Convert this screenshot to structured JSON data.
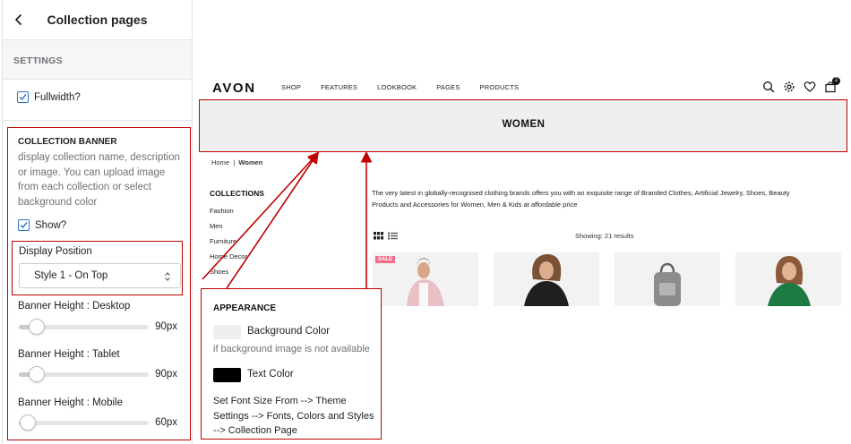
{
  "panel": {
    "title": "Collection pages",
    "settings_label": "SETTINGS",
    "fullwidth_label": "Fullwidth?",
    "fullwidth_checked": true,
    "banner_heading": "COLLECTION BANNER",
    "banner_description": "display collection name, description or image. You can upload image from each collection or select background color",
    "show_label": "Show?",
    "show_checked": true,
    "display_position_label": "Display Position",
    "display_position_value": "Style 1 - On Top",
    "sliders": [
      {
        "label": "Banner Height : Desktop",
        "value_text": "90px"
      },
      {
        "label": "Banner Height : Tablet",
        "value_text": "90px"
      },
      {
        "label": "Banner Height : Mobile",
        "value_text": "60px"
      }
    ]
  },
  "store": {
    "logo": "AVON",
    "nav": [
      "SHOP",
      "FEATURES",
      "LOOKBOOK",
      "PAGES",
      "PRODUCTS"
    ],
    "icons": [
      "search-icon",
      "gear-icon",
      "heart-icon",
      "cart-icon"
    ],
    "cart_count": "2",
    "banner_title": "WOMEN",
    "breadcrumb_home": "Home",
    "breadcrumb_sep": "|",
    "breadcrumb_current": "Women",
    "collections_title": "COLLECTIONS",
    "collections": [
      "Fashion",
      "Men",
      "Furniture",
      "Home Decor",
      "Shoes"
    ],
    "intro": "The very latest in globally-recognised clothing brands offers you with an exquisite range of Branded Clothes, Artificial Jewelry, Shoes, Beauty Products and Accessories for Women, Men & Kids at affordable price",
    "showing": "Showing: 21 results",
    "sale_badge": "SALE",
    "product_count_shown": 4
  },
  "appearance": {
    "title": "APPEARANCE",
    "bg_color_label": "Background Color",
    "bg_color_value": "#efefef",
    "bg_hint": "if background image is not available",
    "text_color_label": "Text Color",
    "text_color_value": "#000000",
    "note": "Set Font Size From --> Theme Settings --> Fonts, Colors and Styles --> Collection Page"
  },
  "colors": {
    "annotation_red": "#c00000",
    "checkbox_blue": "#2c6ecb"
  }
}
